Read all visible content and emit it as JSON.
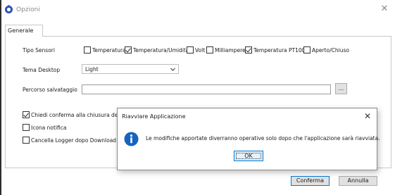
{
  "window": {
    "title": "Opzioni"
  },
  "tabs": [
    {
      "label": "Generale"
    }
  ],
  "general": {
    "sensor_type_label": "Tipo Sensori",
    "sensors": [
      {
        "label": "Temperatura",
        "checked": false
      },
      {
        "label": "Temperatura/Umidità",
        "checked": true
      },
      {
        "label": "Volt",
        "checked": false
      },
      {
        "label": "Milliampere",
        "checked": false
      },
      {
        "label": "Temperatura PT100",
        "checked": true
      },
      {
        "label": "Aperto/Chiuso",
        "checked": false
      }
    ],
    "desktop_theme_label": "Tema Desktop",
    "desktop_theme_value": "Light",
    "save_path_label": "Percorso salvataggio",
    "save_path_value": "",
    "browse_label": "...",
    "options": [
      {
        "label": "Chiedi conferma alla chiusura del prog",
        "checked": true
      },
      {
        "label": "Icona notifica",
        "checked": false
      },
      {
        "label": "Cancella Logger dopo Download",
        "checked": false
      }
    ]
  },
  "buttons": {
    "confirm": "Conferma",
    "cancel": "Annulla"
  },
  "dialog": {
    "title": "Riavviare Applicazione",
    "message": "Le modifiche apportate diverranno operative solo dopo che l'applicazione sarà riavviata.",
    "ok_label": "OK"
  },
  "colors": {
    "accent": "#0078d7",
    "info_icon": "#1565c0",
    "app_icon": "#2b4fb3"
  },
  "icons": {
    "app": "gear-icon",
    "close": "close-icon",
    "chevron": "chevron-down-icon",
    "info": "info-icon"
  }
}
